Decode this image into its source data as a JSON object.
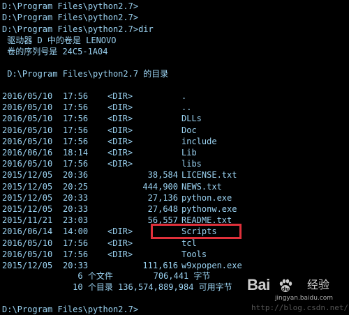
{
  "console": {
    "prompt_lines": [
      "D:\\Program Files\\python2.7>",
      "D:\\Program Files\\python2.7>",
      "D:\\Program Files\\python2.7>dir"
    ],
    "volume_line": " 驱动器 D 中的卷是 LENOVO",
    "serial_line": " 卷的序列号是 24C5-1A04",
    "directory_of": " D:\\Program Files\\python2.7 的目录",
    "entries": [
      {
        "date": "2016/05/10",
        "time": "17:56",
        "dir": "<DIR>",
        "size": "",
        "name": "."
      },
      {
        "date": "2016/05/10",
        "time": "17:56",
        "dir": "<DIR>",
        "size": "",
        "name": ".."
      },
      {
        "date": "2016/05/10",
        "time": "17:56",
        "dir": "<DIR>",
        "size": "",
        "name": "DLLs"
      },
      {
        "date": "2016/05/10",
        "time": "17:56",
        "dir": "<DIR>",
        "size": "",
        "name": "Doc"
      },
      {
        "date": "2016/05/10",
        "time": "17:56",
        "dir": "<DIR>",
        "size": "",
        "name": "include"
      },
      {
        "date": "2016/06/16",
        "time": "18:14",
        "dir": "<DIR>",
        "size": "",
        "name": "Lib"
      },
      {
        "date": "2016/05/10",
        "time": "17:56",
        "dir": "<DIR>",
        "size": "",
        "name": "libs"
      },
      {
        "date": "2015/12/05",
        "time": "20:36",
        "dir": "",
        "size": "38,584",
        "name": "LICENSE.txt"
      },
      {
        "date": "2015/12/05",
        "time": "20:25",
        "dir": "",
        "size": "444,900",
        "name": "NEWS.txt"
      },
      {
        "date": "2015/12/05",
        "time": "20:33",
        "dir": "",
        "size": "27,136",
        "name": "python.exe"
      },
      {
        "date": "2015/12/05",
        "time": "20:33",
        "dir": "",
        "size": "27,648",
        "name": "pythonw.exe"
      },
      {
        "date": "2015/11/21",
        "time": "23:03",
        "dir": "",
        "size": "56,557",
        "name": "README.txt"
      },
      {
        "date": "2016/06/14",
        "time": "14:00",
        "dir": "<DIR>",
        "size": "",
        "name": "Scripts"
      },
      {
        "date": "2016/05/10",
        "time": "17:56",
        "dir": "<DIR>",
        "size": "",
        "name": "tcl"
      },
      {
        "date": "2016/05/10",
        "time": "17:56",
        "dir": "<DIR>",
        "size": "",
        "name": "Tools"
      },
      {
        "date": "2015/12/05",
        "time": "20:33",
        "dir": "",
        "size": "111,616",
        "name": "w9xpopen.exe"
      }
    ],
    "summary_files": "               6 个文件        706,441 字节",
    "summary_dirs": "              10 个目录 136,574,889,984 可用字节",
    "final_prompt": "D:\\Program Files\\python2.7>"
  },
  "watermark": {
    "brand": "Bai  经验",
    "brand_left": "Bai",
    "brand_right": "经验",
    "url": "jingyan.baidu.com",
    "blog": "http://blog.csdn.net/"
  },
  "colors": {
    "background": "#000000",
    "text": "#9bd3f2",
    "highlight": "#e0303a"
  }
}
